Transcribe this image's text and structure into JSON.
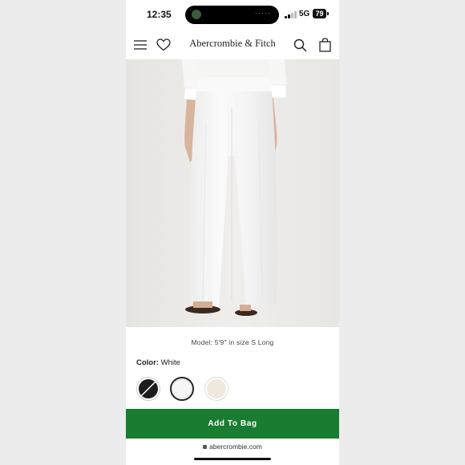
{
  "status_bar": {
    "time": "12:35",
    "network": "5G",
    "battery": "79",
    "island_dots": "·····"
  },
  "nav": {
    "brand": "Abercrombie & Fitch",
    "icons": [
      "menu-icon",
      "heart-icon",
      "search-icon",
      "bag-icon"
    ]
  },
  "product": {
    "image_alt": "Woman in white wide-leg linen pants",
    "model_note": "Model: 5'9\" in size S Long",
    "color_label": "Color:",
    "color_value": "White",
    "swatches": [
      {
        "name": "black",
        "color": "#1c1c1c",
        "selected": false
      },
      {
        "name": "white",
        "color": "#f6f6f6",
        "selected": true
      },
      {
        "name": "cream",
        "color": "#efe8dc",
        "selected": false
      }
    ]
  },
  "cta": {
    "add_to_bag": "Add To Bag",
    "color": "#1a7c31"
  },
  "browser": {
    "url": "abercrombie.com"
  }
}
